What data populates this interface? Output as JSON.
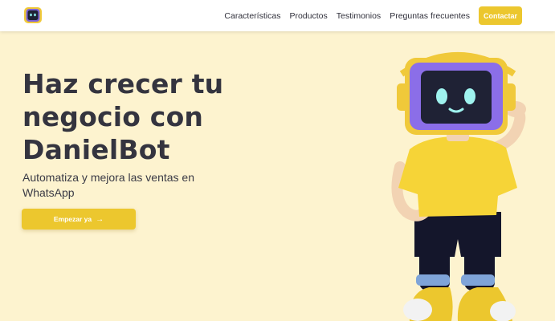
{
  "nav": {
    "logo_icon": "robot-logo-icon",
    "links": [
      "Características",
      "Productos",
      "Testimonios",
      "Preguntas frecuentes"
    ],
    "contact_label": "Contactar"
  },
  "hero": {
    "title": "Haz crecer tu negocio con DanielBot",
    "subtitle": "Automatiza y mejora las ventas en WhatsApp",
    "cta_label": "Empezar ya",
    "cta_icon": "arrow-right-icon",
    "illustration": "robot-mascot-illustration"
  },
  "colors": {
    "background": "#fdf3cf",
    "accent": "#ecc72e",
    "text": "#34343f",
    "robot_frame": "#8b6ee8"
  }
}
